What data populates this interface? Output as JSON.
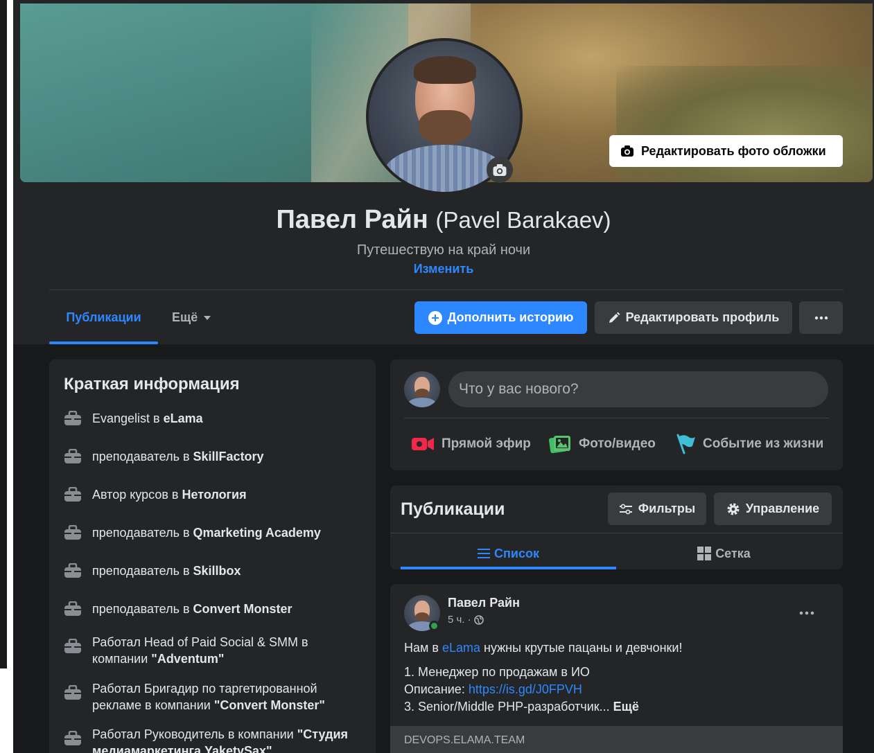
{
  "colors": {
    "accent": "#2d88ff",
    "bg": "#18191a",
    "card": "#242526",
    "online": "#31a24c"
  },
  "cover": {
    "edit_button": "Редактировать фото обложки",
    "icon": "camera-icon"
  },
  "profile": {
    "name": "Павел Райн",
    "alt_name": "(Pavel Barakaev)",
    "bio": "Путешествую на край ночи",
    "bio_edit": "Изменить"
  },
  "tabs": {
    "publications": "Публикации",
    "more": "Ещё"
  },
  "actions": {
    "add_story": "Дополнить историю",
    "edit_profile": "Редактировать профиль"
  },
  "intro": {
    "title": "Краткая информация",
    "items": [
      {
        "prefix": "Evangelist в ",
        "bold": "eLama",
        "suffix": ""
      },
      {
        "prefix": "преподаватель в ",
        "bold": "SkillFactory",
        "suffix": ""
      },
      {
        "prefix": "Автор курсов в ",
        "bold": "Нетология",
        "suffix": ""
      },
      {
        "prefix": "преподаватель в ",
        "bold": "Qmarketing Academy",
        "suffix": ""
      },
      {
        "prefix": "преподаватель в ",
        "bold": "Skillbox",
        "suffix": ""
      },
      {
        "prefix": "преподаватель в ",
        "bold": "Convert Monster",
        "suffix": ""
      },
      {
        "prefix": "Работал Head of Paid Social & SMM в компании ",
        "bold": "\"Adventum\"",
        "suffix": ""
      },
      {
        "prefix": "Работал Бригадир по таргетированной рекламе в компании ",
        "bold": "\"Convert Monster\"",
        "suffix": ""
      },
      {
        "prefix": "Работал Руководитель в компании ",
        "bold": "\"Студия медиамаркетинга YaketySax\"",
        "suffix": ""
      }
    ]
  },
  "composer": {
    "placeholder": "Что у вас нового?",
    "live": "Прямой эфир",
    "photo": "Фото/видео",
    "event": "Событие из жизни"
  },
  "posts": {
    "title": "Публикации",
    "filters": "Фильтры",
    "manage": "Управление",
    "view_list": "Список",
    "view_grid": "Сетка"
  },
  "post": {
    "author": "Павел Райн",
    "time": "5 ч. ·",
    "text_before_link": "Нам в ",
    "text_link": "eLama",
    "text_after_link": " нужны крутые пацаны и девчонки!",
    "line2": "1. Менеджер по продажам в ИО",
    "line3_label": "Описание: ",
    "line3_link": "https://is.gd/J0FPVH",
    "line4": "3. Senior/Middle PHP-разработчик... ",
    "line4_more": "Ещё",
    "link_domain": "DEVOPS.ELAMA.TEAM"
  }
}
